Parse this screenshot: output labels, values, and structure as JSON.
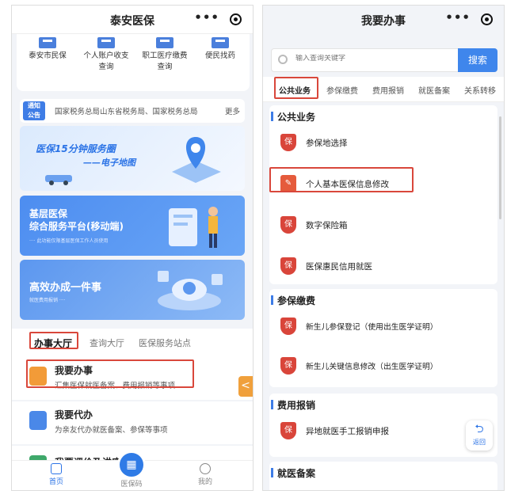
{
  "left": {
    "title": "泰安医保",
    "quick": [
      {
        "label": "泰安市民保",
        "label2": ""
      },
      {
        "label": "个人账户收支",
        "label2": "查询"
      },
      {
        "label": "职工医疗缴费",
        "label2": "查询"
      },
      {
        "label": "便民找药",
        "label2": ""
      }
    ],
    "notice": {
      "badge1": "通知",
      "badge2": "公告",
      "text": "国家税务总局山东省税务局、国家税务总局",
      "more": "更多"
    },
    "banners": {
      "b1_line1": "医保15分钟服务圈",
      "b1_line2": "——电子地图",
      "b2_line1": "基层医保",
      "b2_line2": "综合服务平台(移动端)",
      "b2_sub": "···· 此功能仅限基层医保工作人员使用",
      "b3_line1": "高效办成一件事",
      "b3_sub": "就医费用报销 ····"
    },
    "tabs": [
      "办事大厅",
      "查询大厅",
      "医保服务站点"
    ],
    "services": [
      {
        "title": "我要办事",
        "sub": "汇集医保就医备案、费用报销等事项"
      },
      {
        "title": "我要代办",
        "sub": "为亲友代办就医备案、参保等事项"
      },
      {
        "title": "我要评价及讲座",
        "sub": ""
      }
    ],
    "side_arrow": "<",
    "nav": {
      "home": "首页",
      "code": "医保码",
      "mine": "我的"
    }
  },
  "right": {
    "title": "我要办事",
    "search": {
      "placeholder": "输入查询关键字",
      "button": "搜索"
    },
    "cats": [
      "公共业务",
      "参保缴费",
      "费用报销",
      "就医备案",
      "关系转移"
    ],
    "sections": [
      {
        "header": "公共业务",
        "items": [
          "参保地选择",
          "个人基本医保信息修改",
          "数字保险箱",
          "医保惠民信用就医"
        ]
      },
      {
        "header": "参保缴费",
        "items": [
          "新生儿参保登记（使用出生医学证明）",
          "新生儿关键信息修改（出生医学证明）"
        ]
      },
      {
        "header": "费用报销",
        "items": [
          "异地就医手工报销申报"
        ]
      },
      {
        "header": "就医备案",
        "items": []
      }
    ],
    "back": "返回",
    "icon_char": "保"
  },
  "colors": {
    "accent": "#3f7de6",
    "highlight": "#d9473b",
    "orange": "#f0a03c"
  }
}
